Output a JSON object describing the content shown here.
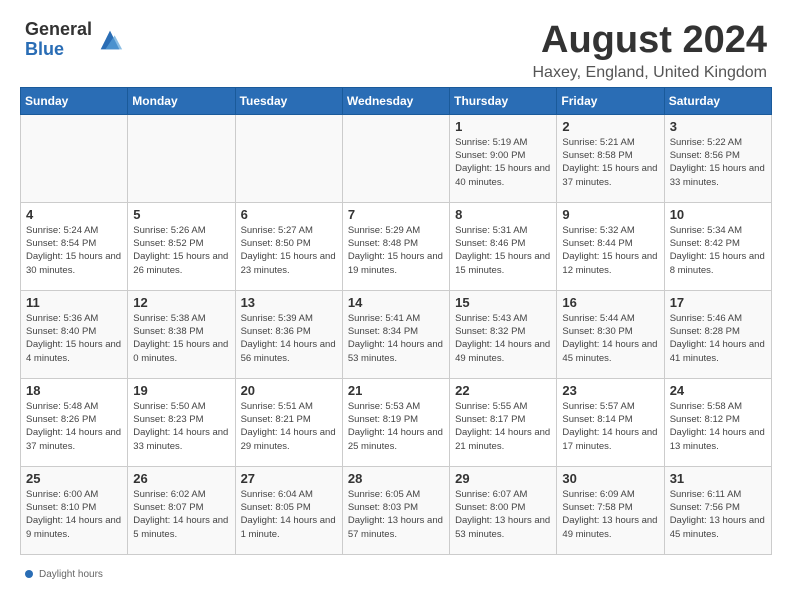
{
  "header": {
    "logo_general": "General",
    "logo_blue": "Blue",
    "month_title": "August 2024",
    "location": "Haxey, England, United Kingdom"
  },
  "footer": {
    "daylight_label": "Daylight hours"
  },
  "calendar": {
    "days_of_week": [
      "Sunday",
      "Monday",
      "Tuesday",
      "Wednesday",
      "Thursday",
      "Friday",
      "Saturday"
    ],
    "weeks": [
      [
        {
          "day": "",
          "info": ""
        },
        {
          "day": "",
          "info": ""
        },
        {
          "day": "",
          "info": ""
        },
        {
          "day": "",
          "info": ""
        },
        {
          "day": "1",
          "info": "Sunrise: 5:19 AM\nSunset: 9:00 PM\nDaylight: 15 hours\nand 40 minutes."
        },
        {
          "day": "2",
          "info": "Sunrise: 5:21 AM\nSunset: 8:58 PM\nDaylight: 15 hours\nand 37 minutes."
        },
        {
          "day": "3",
          "info": "Sunrise: 5:22 AM\nSunset: 8:56 PM\nDaylight: 15 hours\nand 33 minutes."
        }
      ],
      [
        {
          "day": "4",
          "info": "Sunrise: 5:24 AM\nSunset: 8:54 PM\nDaylight: 15 hours\nand 30 minutes."
        },
        {
          "day": "5",
          "info": "Sunrise: 5:26 AM\nSunset: 8:52 PM\nDaylight: 15 hours\nand 26 minutes."
        },
        {
          "day": "6",
          "info": "Sunrise: 5:27 AM\nSunset: 8:50 PM\nDaylight: 15 hours\nand 23 minutes."
        },
        {
          "day": "7",
          "info": "Sunrise: 5:29 AM\nSunset: 8:48 PM\nDaylight: 15 hours\nand 19 minutes."
        },
        {
          "day": "8",
          "info": "Sunrise: 5:31 AM\nSunset: 8:46 PM\nDaylight: 15 hours\nand 15 minutes."
        },
        {
          "day": "9",
          "info": "Sunrise: 5:32 AM\nSunset: 8:44 PM\nDaylight: 15 hours\nand 12 minutes."
        },
        {
          "day": "10",
          "info": "Sunrise: 5:34 AM\nSunset: 8:42 PM\nDaylight: 15 hours\nand 8 minutes."
        }
      ],
      [
        {
          "day": "11",
          "info": "Sunrise: 5:36 AM\nSunset: 8:40 PM\nDaylight: 15 hours\nand 4 minutes."
        },
        {
          "day": "12",
          "info": "Sunrise: 5:38 AM\nSunset: 8:38 PM\nDaylight: 15 hours\nand 0 minutes."
        },
        {
          "day": "13",
          "info": "Sunrise: 5:39 AM\nSunset: 8:36 PM\nDaylight: 14 hours\nand 56 minutes."
        },
        {
          "day": "14",
          "info": "Sunrise: 5:41 AM\nSunset: 8:34 PM\nDaylight: 14 hours\nand 53 minutes."
        },
        {
          "day": "15",
          "info": "Sunrise: 5:43 AM\nSunset: 8:32 PM\nDaylight: 14 hours\nand 49 minutes."
        },
        {
          "day": "16",
          "info": "Sunrise: 5:44 AM\nSunset: 8:30 PM\nDaylight: 14 hours\nand 45 minutes."
        },
        {
          "day": "17",
          "info": "Sunrise: 5:46 AM\nSunset: 8:28 PM\nDaylight: 14 hours\nand 41 minutes."
        }
      ],
      [
        {
          "day": "18",
          "info": "Sunrise: 5:48 AM\nSunset: 8:26 PM\nDaylight: 14 hours\nand 37 minutes."
        },
        {
          "day": "19",
          "info": "Sunrise: 5:50 AM\nSunset: 8:23 PM\nDaylight: 14 hours\nand 33 minutes."
        },
        {
          "day": "20",
          "info": "Sunrise: 5:51 AM\nSunset: 8:21 PM\nDaylight: 14 hours\nand 29 minutes."
        },
        {
          "day": "21",
          "info": "Sunrise: 5:53 AM\nSunset: 8:19 PM\nDaylight: 14 hours\nand 25 minutes."
        },
        {
          "day": "22",
          "info": "Sunrise: 5:55 AM\nSunset: 8:17 PM\nDaylight: 14 hours\nand 21 minutes."
        },
        {
          "day": "23",
          "info": "Sunrise: 5:57 AM\nSunset: 8:14 PM\nDaylight: 14 hours\nand 17 minutes."
        },
        {
          "day": "24",
          "info": "Sunrise: 5:58 AM\nSunset: 8:12 PM\nDaylight: 14 hours\nand 13 minutes."
        }
      ],
      [
        {
          "day": "25",
          "info": "Sunrise: 6:00 AM\nSunset: 8:10 PM\nDaylight: 14 hours\nand 9 minutes."
        },
        {
          "day": "26",
          "info": "Sunrise: 6:02 AM\nSunset: 8:07 PM\nDaylight: 14 hours\nand 5 minutes."
        },
        {
          "day": "27",
          "info": "Sunrise: 6:04 AM\nSunset: 8:05 PM\nDaylight: 14 hours\nand 1 minute."
        },
        {
          "day": "28",
          "info": "Sunrise: 6:05 AM\nSunset: 8:03 PM\nDaylight: 13 hours\nand 57 minutes."
        },
        {
          "day": "29",
          "info": "Sunrise: 6:07 AM\nSunset: 8:00 PM\nDaylight: 13 hours\nand 53 minutes."
        },
        {
          "day": "30",
          "info": "Sunrise: 6:09 AM\nSunset: 7:58 PM\nDaylight: 13 hours\nand 49 minutes."
        },
        {
          "day": "31",
          "info": "Sunrise: 6:11 AM\nSunset: 7:56 PM\nDaylight: 13 hours\nand 45 minutes."
        }
      ]
    ]
  }
}
